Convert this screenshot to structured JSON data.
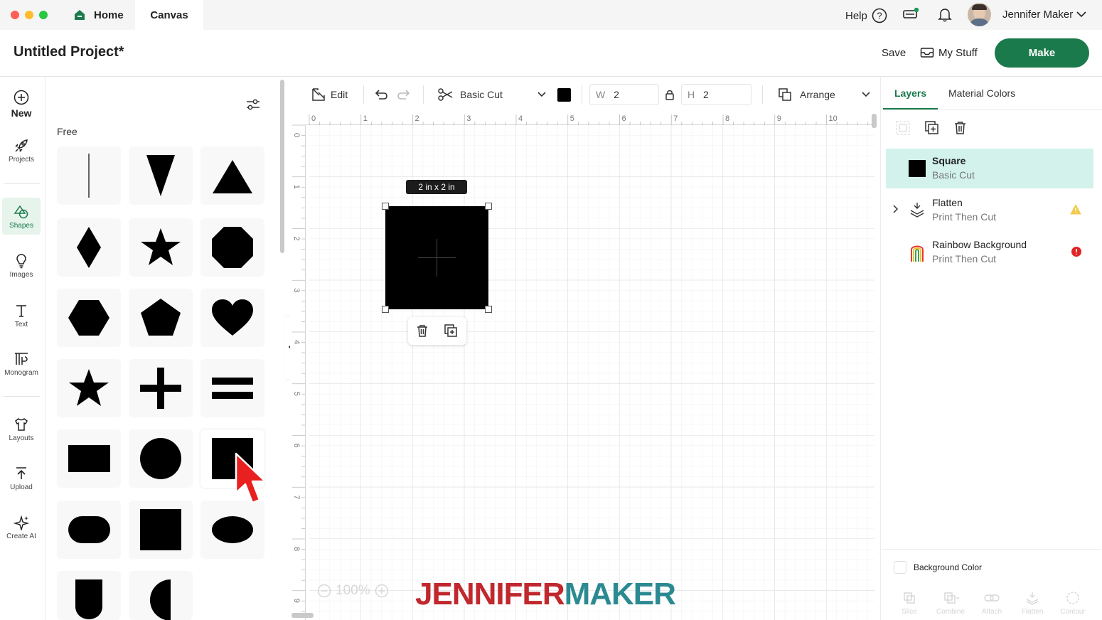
{
  "window": {
    "tabs": [
      {
        "label": "Home"
      },
      {
        "label": "Canvas"
      }
    ],
    "help_label": "Help",
    "user_name": "Jennifer Maker"
  },
  "project": {
    "title": "Untitled Project*",
    "save_label": "Save",
    "mystuff_label": "My Stuff",
    "make_label": "Make"
  },
  "rail": {
    "items": [
      {
        "label": "New",
        "icon": "plus-circle-icon"
      },
      {
        "label": "Projects",
        "icon": "rocket-icon"
      },
      {
        "label": "Shapes",
        "icon": "shapes-icon"
      },
      {
        "label": "Images",
        "icon": "lightbulb-icon"
      },
      {
        "label": "Text",
        "icon": "text-icon"
      },
      {
        "label": "Monogram",
        "icon": "monogram-icon"
      },
      {
        "label": "Layouts",
        "icon": "tshirt-icon"
      },
      {
        "label": "Upload",
        "icon": "upload-icon"
      },
      {
        "label": "Create AI",
        "icon": "sparkle-icon"
      }
    ],
    "active": "Shapes"
  },
  "shapes_panel": {
    "section_label": "Free",
    "shapes": [
      "line",
      "inverted-triangle",
      "triangle",
      "diamond",
      "star",
      "octagon",
      "hexagon",
      "pentagon",
      "heart",
      "star-outline",
      "plus",
      "equals",
      "rectangle",
      "circle",
      "square",
      "rounded-rectangle",
      "square",
      "oval",
      "shield",
      "half-circle"
    ]
  },
  "toolbar": {
    "edit_label": "Edit",
    "operation_label": "Basic Cut",
    "color": "#000000",
    "w_label": "W",
    "w_value": "2",
    "h_label": "H",
    "h_value": "2",
    "arrange_label": "Arrange"
  },
  "canvas": {
    "ruler_h": [
      "0",
      "1",
      "2",
      "3",
      "4",
      "5",
      "6",
      "7",
      "8",
      "9",
      "10"
    ],
    "ruler_v": [
      "0",
      "1",
      "2",
      "3",
      "4",
      "5",
      "6",
      "7",
      "8",
      "9"
    ],
    "size_tag": "2  in x 2  in",
    "zoom_label": "100%"
  },
  "layers_panel": {
    "tabs": [
      {
        "label": "Layers"
      },
      {
        "label": "Material Colors"
      }
    ],
    "active_tab": "Layers",
    "layers": [
      {
        "name": "Square",
        "sub": "Basic Cut",
        "selected": true,
        "status": ""
      },
      {
        "name": "Flatten",
        "sub": "Print Then Cut",
        "selected": false,
        "status": "warning"
      },
      {
        "name": "Rainbow Background",
        "sub": "Print Then Cut",
        "selected": false,
        "status": "error"
      }
    ],
    "background_color_label": "Background Color",
    "bottom_actions": [
      "Slice",
      "Combine",
      "Attach",
      "Flatten",
      "Contour"
    ]
  },
  "watermark": {
    "part1": "JENNIFER",
    "part2": "MAKER"
  },
  "colors": {
    "accent": "#1b7a4b",
    "selected_layer": "#d3f2ec",
    "warning": "#f2c94c",
    "error": "#e02424",
    "watermark_red": "#c0282d",
    "watermark_teal": "#2b8a91"
  }
}
